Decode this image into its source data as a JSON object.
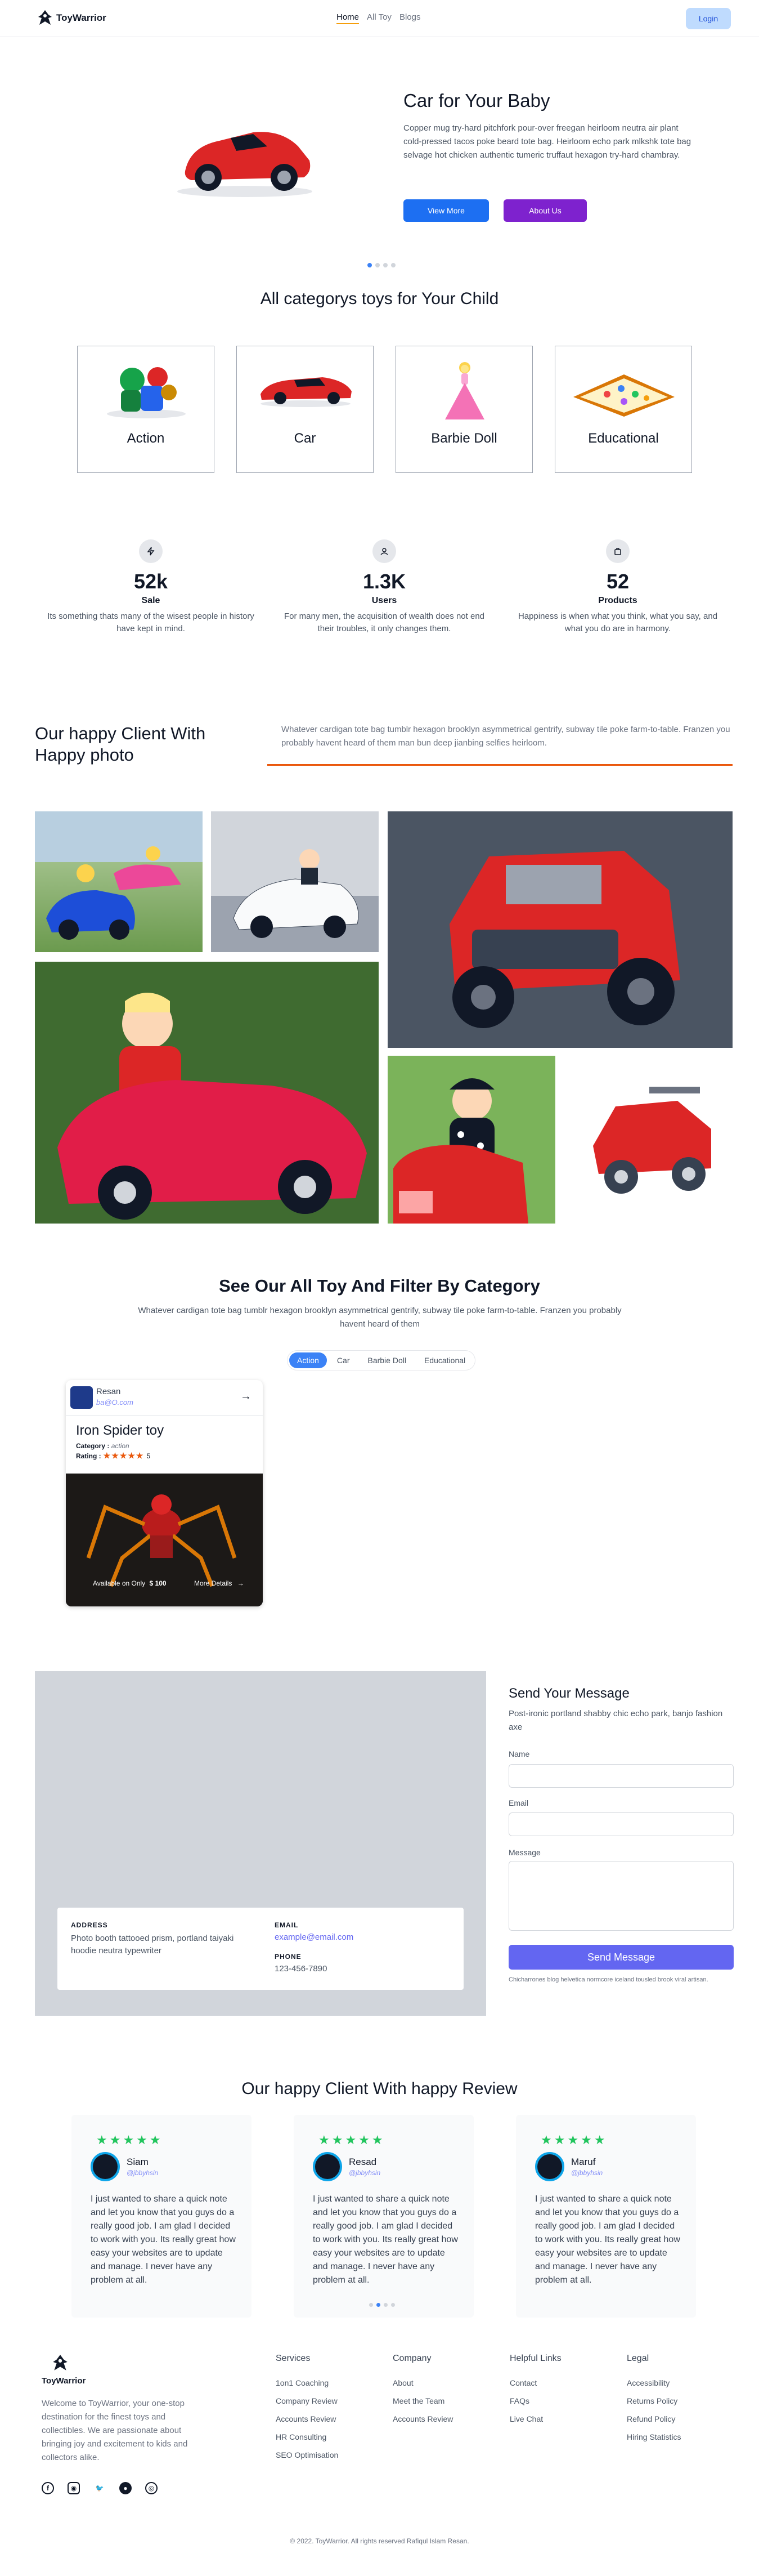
{
  "nav": {
    "brand": "ToyWarrior",
    "links": [
      "Home",
      "All Toy",
      "Blogs"
    ],
    "login_label": "Login"
  },
  "hero": {
    "title": "Car for Your Baby",
    "text": "Copper mug try-hard pitchfork pour-over freegan heirloom neutra air plant cold-pressed tacos poke beard tote bag. Heirloom echo park mlkshk tote bag selvage hot chicken authentic tumeric truffaut hexagon try-hard chambray.",
    "btn_view": "View More",
    "btn_about": "About Us"
  },
  "categories": {
    "title": "All categorys toys for Your Child",
    "items": [
      "Action",
      "Car",
      "Barbie Doll",
      "Educational"
    ]
  },
  "stats": [
    {
      "value": "52k",
      "label": "Sale",
      "desc": "Its something thats many of the wisest people in history have kept in mind."
    },
    {
      "value": "1.3K",
      "label": "Users",
      "desc": "For many men, the acquisition of wealth does not end their troubles, it only changes them."
    },
    {
      "value": "52",
      "label": "Products",
      "desc": "Happiness is when what you think, what you say, and what you do are in harmony."
    }
  ],
  "gallery": {
    "title": "Our happy Client With Happy photo",
    "text": "Whatever cardigan tote bag tumblr hexagon brooklyn asymmetrical gentrify, subway tile poke farm-to-table. Franzen you probably havent heard of them man bun deep jianbing selfies heirloom."
  },
  "filter": {
    "title": "See Our All Toy And Filter By Category",
    "text": "Whatever cardigan tote bag tumblr hexagon brooklyn asymmetrical gentrify, subway tile poke farm-to-table. Franzen you probably havent heard of them",
    "tabs": [
      "Action",
      "Car",
      "Barbie Doll",
      "Educational"
    ]
  },
  "product": {
    "seller": "Resan",
    "email": "ba@O.com",
    "name": "Iron Spider toy",
    "category_label": "Category :",
    "category": "action",
    "rating_label": "Rating :",
    "rating_value": "5",
    "available": "Available on Only",
    "price": "$ 100",
    "details": "More Details"
  },
  "contact": {
    "address_label": "ADDRESS",
    "address": "Photo booth tattooed prism, portland taiyaki hoodie neutra typewriter",
    "email_label": "EMAIL",
    "email": "example@email.com",
    "phone_label": "PHONE",
    "phone": "123-456-7890",
    "form_title": "Send Your Message",
    "form_text": "Post-ironic portland shabby chic echo park, banjo fashion axe",
    "name_label": "Name",
    "email_field_label": "Email",
    "message_label": "Message",
    "send_label": "Send Message",
    "note": "Chicharrones blog helvetica normcore iceland tousled brook viral artisan."
  },
  "reviews": {
    "title": "Our happy Client With happy Review",
    "stars": "★★★★★",
    "items": [
      {
        "name": "Siam",
        "handle": "@jbbyhsin",
        "text": "I just wanted to share a quick note and let you know that you guys do a really good job. I am glad I decided to work with you. Its really great how easy your websites are to update and manage. I never have any problem at all."
      },
      {
        "name": "Resad",
        "handle": "@jbbyhsin",
        "text": "I just wanted to share a quick note and let you know that you guys do a really good job. I am glad I decided to work with you. Its really great how easy your websites are to update and manage. I never have any problem at all."
      },
      {
        "name": "Maruf",
        "handle": "@jbbyhsin",
        "text": "I just wanted to share a quick note and let you know that you guys do a really good job. I am glad I decided to work with you. Its really great how easy your websites are to update and manage. I never have any problem at all."
      }
    ]
  },
  "footer": {
    "brand": "ToyWarrior",
    "about": "Welcome to ToyWarrior, your one-stop destination for the finest toys and collectibles. We are passionate about bringing joy and excitement to kids and collectors alike.",
    "cols": [
      {
        "title": "Services",
        "links": [
          "1on1 Coaching",
          "Company Review",
          "Accounts Review",
          "HR Consulting",
          "SEO Optimisation"
        ]
      },
      {
        "title": "Company",
        "links": [
          "About",
          "Meet the Team",
          "Accounts Review"
        ]
      },
      {
        "title": "Helpful Links",
        "links": [
          "Contact",
          "FAQs",
          "Live Chat"
        ]
      },
      {
        "title": "Legal",
        "links": [
          "Accessibility",
          "Returns Policy",
          "Refund Policy",
          "Hiring Statistics"
        ]
      }
    ],
    "copyright": "© 2022. ToyWarrior. All rights reserved Rafiqul Islam Resan."
  }
}
